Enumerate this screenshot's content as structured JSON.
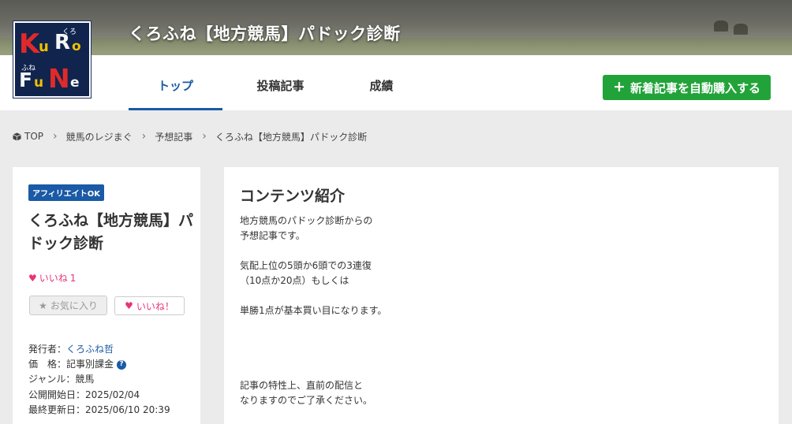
{
  "header": {
    "site_title": "くろふね【地方競馬】パドック診断",
    "logo": {
      "letters": [
        "K",
        "u",
        "R",
        "o",
        "F",
        "u",
        "N",
        "e"
      ],
      "small_top": "くろ",
      "small_bottom": "ふね"
    }
  },
  "nav": {
    "tabs": [
      {
        "label": "トップ",
        "active": true
      },
      {
        "label": "投稿記事",
        "active": false
      },
      {
        "label": "成績",
        "active": false
      }
    ],
    "buy_button": "新着記事を自動購入する"
  },
  "breadcrumb": [
    "TOP",
    "競馬のレジまぐ",
    "予想記事",
    "くろふね【地方競馬】パドック診断"
  ],
  "magazine": {
    "badge": "アフィリエイトOK",
    "title": "くろふね【地方競馬】パドック診断",
    "like_label": "いいね",
    "like_count": "1",
    "fav_button": "お気に入り",
    "like_button": "いいね！",
    "meta": {
      "publisher_label": "発行者：",
      "publisher": "くろふね哲",
      "price_label": "価　格：",
      "price": "記事別課金",
      "genre_label": "ジャンル：",
      "genre": "競馬",
      "start_label": "公開開始日：",
      "start": "2025/02/04",
      "updated_label": "最終更新日：",
      "updated": "2025/06/10 20:39"
    }
  },
  "content": {
    "title": "コンテンツ紹介",
    "body": "地方競馬のパドック診断からの\n予想記事です。\n\n気配上位の5頭か6頭での3連復\n（10点か20点）もしくは\n\n単勝1点が基本買い目になります。\n\n\n\n\n記事の特性上、直前の配信と\nなりますのでご了承ください。\n\nオッズや前走成績は全く見ずに"
  },
  "colors": {
    "accent": "#1a5aa6",
    "buy": "#22a33a",
    "like": "#e8337a",
    "logo_bg": "#10244e"
  }
}
